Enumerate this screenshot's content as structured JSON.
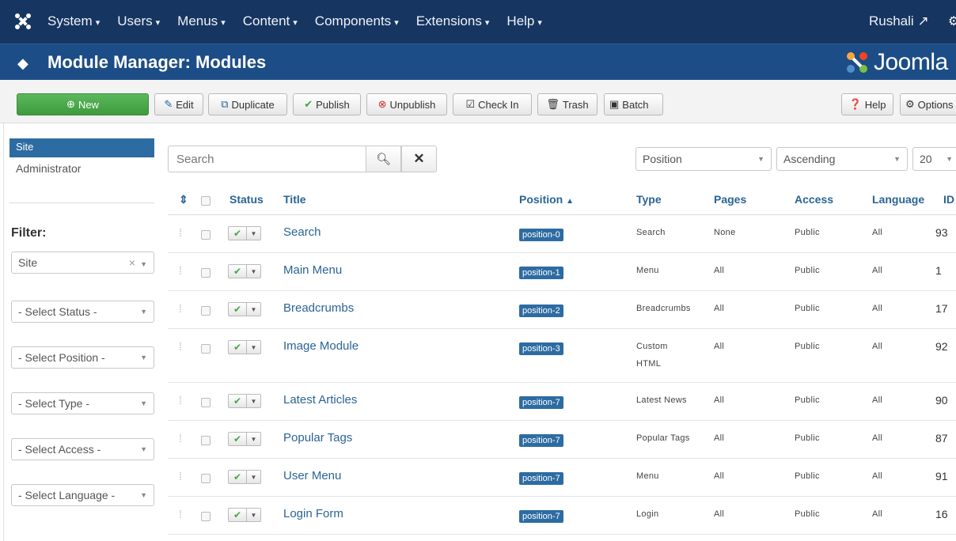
{
  "navbar": {
    "menus": [
      "System",
      "Users",
      "Menus",
      "Content",
      "Components",
      "Extensions",
      "Help"
    ],
    "user": "Rushali"
  },
  "header": {
    "title": "Module Manager: Modules",
    "brand": "Joomla"
  },
  "toolbar": {
    "new": "New",
    "edit": "Edit",
    "duplicate": "Duplicate",
    "publish": "Publish",
    "unpublish": "Unpublish",
    "checkin": "Check In",
    "trash": "Trash",
    "batch": "Batch",
    "help": "Help",
    "options": "Options"
  },
  "sidebar": {
    "site": "Site",
    "administrator": "Administrator",
    "filter_label": "Filter:",
    "client_select": "Site",
    "status_select": "- Select Status -",
    "position_select": "- Select Position -",
    "type_select": "- Select Type -",
    "access_select": "- Select Access -",
    "language_select": "- Select Language -"
  },
  "search": {
    "placeholder": "Search"
  },
  "sort": {
    "field": "Position",
    "direction": "Ascending",
    "limit": "20"
  },
  "table": {
    "headers": {
      "status": "Status",
      "title": "Title",
      "position": "Position",
      "type": "Type",
      "pages": "Pages",
      "access": "Access",
      "language": "Language",
      "id": "ID"
    },
    "rows": [
      {
        "title": "Search",
        "position": "position-0",
        "type": "Search",
        "type2": "",
        "pages": "None",
        "access": "Public",
        "language": "All",
        "id": "93"
      },
      {
        "title": "Main Menu",
        "position": "position-1",
        "type": "Menu",
        "type2": "",
        "pages": "All",
        "access": "Public",
        "language": "All",
        "id": "1"
      },
      {
        "title": "Breadcrumbs",
        "position": "position-2",
        "type": "Breadcrumbs",
        "type2": "",
        "pages": "All",
        "access": "Public",
        "language": "All",
        "id": "17"
      },
      {
        "title": "Image Module",
        "position": "position-3",
        "type": "Custom",
        "type2": "HTML",
        "pages": "All",
        "access": "Public",
        "language": "All",
        "id": "92"
      },
      {
        "title": "Latest Articles",
        "position": "position-7",
        "type": "Latest News",
        "type2": "",
        "pages": "All",
        "access": "Public",
        "language": "All",
        "id": "90"
      },
      {
        "title": "Popular Tags",
        "position": "position-7",
        "type": "Popular Tags",
        "type2": "",
        "pages": "All",
        "access": "Public",
        "language": "All",
        "id": "87"
      },
      {
        "title": "User Menu",
        "position": "position-7",
        "type": "Menu",
        "type2": "",
        "pages": "All",
        "access": "Public",
        "language": "All",
        "id": "91"
      },
      {
        "title": "Login Form",
        "position": "position-7",
        "type": "Login",
        "type2": "",
        "pages": "All",
        "access": "Public",
        "language": "All",
        "id": "16"
      }
    ]
  }
}
